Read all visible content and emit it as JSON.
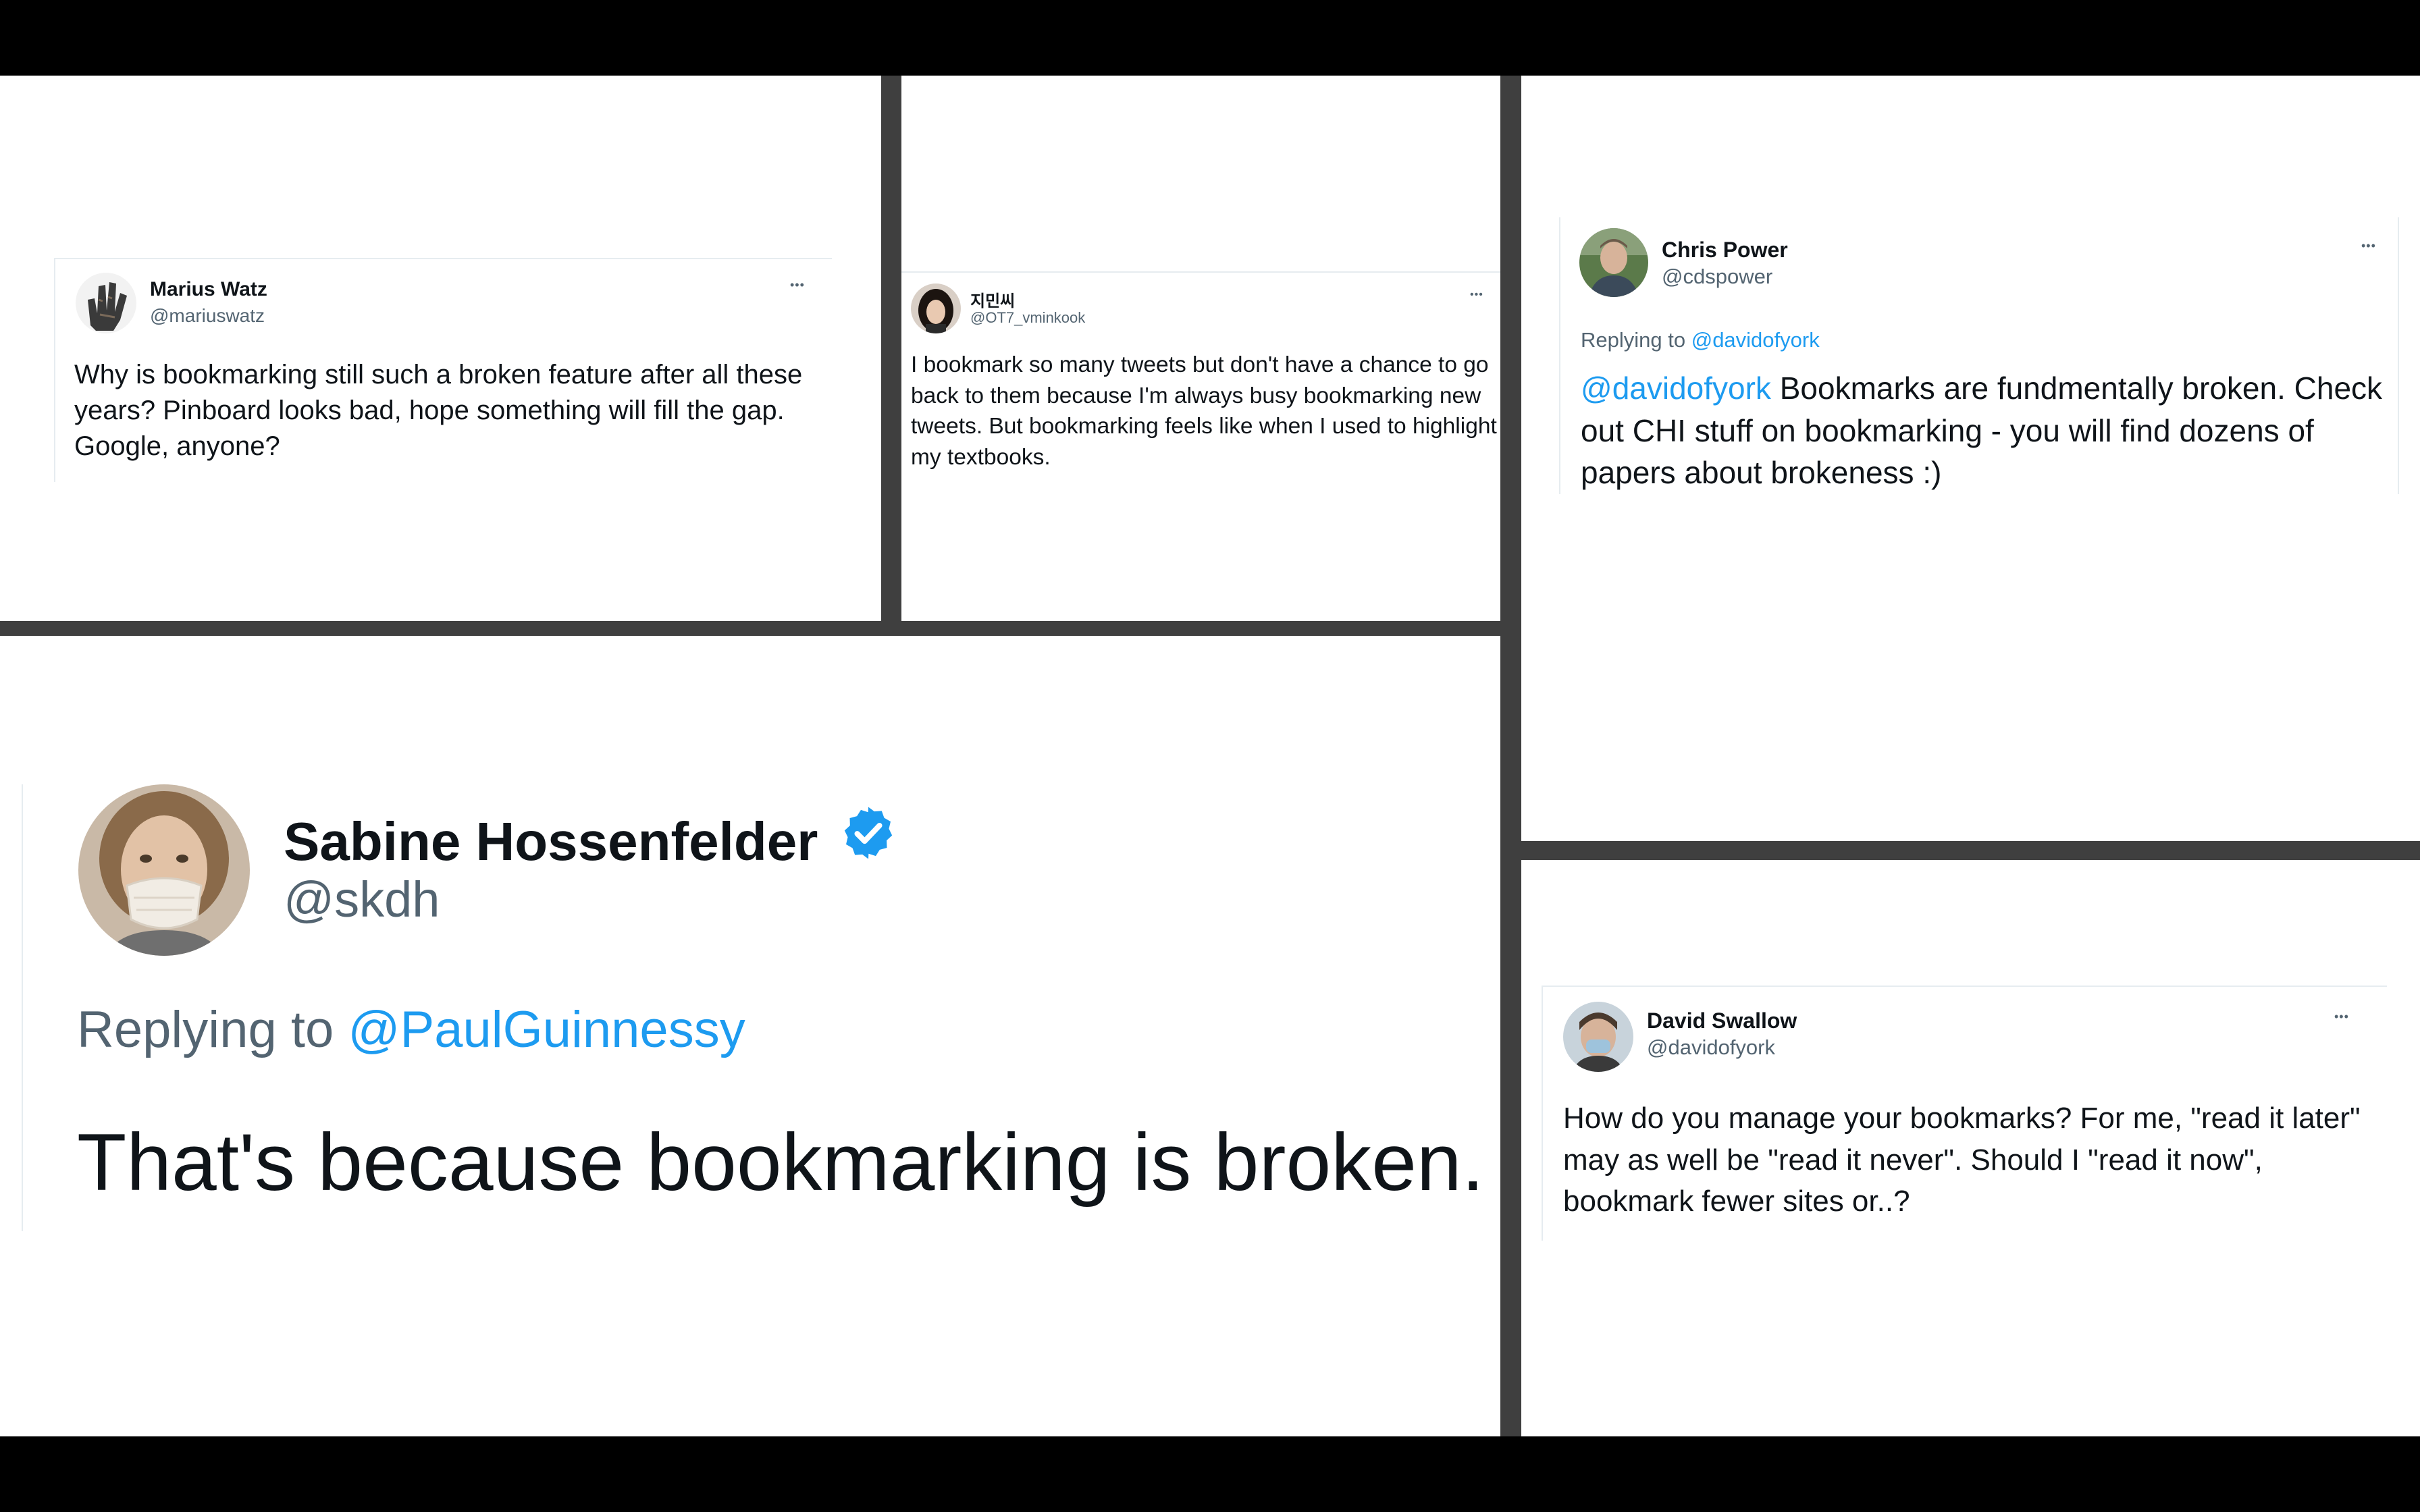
{
  "tweets": {
    "marius": {
      "name": "Marius Watz",
      "handle": "@mariuswatz",
      "text": "Why is bookmarking still such a broken feature after all these years? Pinboard looks bad, hope something will fill the gap. Google, anyone?",
      "more": "•••"
    },
    "jimin": {
      "name": "지민씨",
      "handle": "@OT7_vminkook",
      "text": "I bookmark so many tweets but don't have a chance to go back to them because I'm always busy bookmarking new tweets. But bookmarking feels like when I used to highlight my textbooks.",
      "more": "•••"
    },
    "chris": {
      "name": "Chris Power",
      "handle": "@cdspower",
      "replying_prefix": "Replying to",
      "replying_to": "@davidofyork",
      "mention": "@davidofyork",
      "text": " Bookmarks are fundmentally broken. Check out CHI stuff on bookmarking - you will find dozens of papers about brokeness :)",
      "more": "•••"
    },
    "sabine": {
      "name": "Sabine Hossenfelder",
      "handle": "@skdh",
      "replying_prefix": "Replying to",
      "replying_to": "@PaulGuinnessy",
      "text": "That's because bookmarking is broken.",
      "verified_icon": "verified-badge-icon"
    },
    "david": {
      "name": "David Swallow",
      "handle": "@davidofyork",
      "text": "How do you manage your bookmarks? For me, \"read it later\" may as well be \"read it never\". Should I \"read it now\", bookmark fewer sites or..?",
      "more": "•••"
    }
  },
  "colors": {
    "link": "#1d9bf0",
    "verified": "#1d9bf0",
    "text": "#0f1419",
    "secondary": "#536471",
    "divider": "#3f3f3f",
    "letterbox": "#000000"
  }
}
